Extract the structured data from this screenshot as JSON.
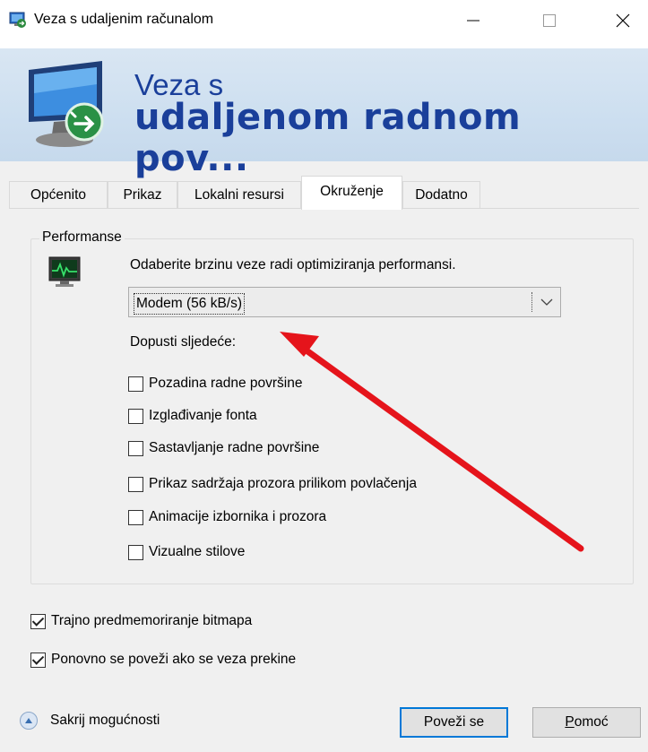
{
  "window": {
    "title": "Veza s udaljenim računalom",
    "icons": {
      "app": "remote-desktop-icon",
      "minimize": "minimize-icon",
      "maximize": "maximize-icon",
      "close": "close-icon"
    }
  },
  "banner": {
    "line1": "Veza s",
    "line2": "udaljenom radnom pov...",
    "icon": "remote-desktop-monitor-icon",
    "color": "#1a3f9a"
  },
  "tabs": [
    {
      "label": "Općenito",
      "active": false
    },
    {
      "label": "Prikaz",
      "active": false
    },
    {
      "label": "Lokalni resursi",
      "active": false
    },
    {
      "label": "Okruženje",
      "active": true
    },
    {
      "label": "Dodatno",
      "active": false
    }
  ],
  "performance": {
    "group_label": "Performanse",
    "description": "Odaberite brzinu veze radi optimiziranja performansi.",
    "speed_select": {
      "value": "Modem (56 kB/s)"
    },
    "allow_label": "Dopusti sljedeće:",
    "options": [
      {
        "label": "Pozadina radne površine",
        "checked": false
      },
      {
        "label": "Izglađivanje fonta",
        "checked": false
      },
      {
        "label": "Sastavljanje radne površine",
        "checked": false
      },
      {
        "label": "Prikaz sadržaja prozora prilikom povlačenja",
        "checked": false
      },
      {
        "label": "Animacije izbornika i prozora",
        "checked": false
      },
      {
        "label": "Vizualne stilove",
        "checked": false
      }
    ]
  },
  "extra_options": [
    {
      "label": "Trajno predmemoriranje bitmapa",
      "checked": true
    },
    {
      "label": "Ponovno se poveži ako se veza prekine",
      "checked": true
    }
  ],
  "footer": {
    "toggle_label": "Sakrij mogućnosti",
    "connect_label": "Poveži se",
    "help_label_first": "P",
    "help_label_rest": "omoć"
  },
  "annotation": {
    "arrow_color": "#e5141b"
  },
  "colors": {
    "accent": "#0078d7",
    "window_bg": "#f0f0f0"
  }
}
